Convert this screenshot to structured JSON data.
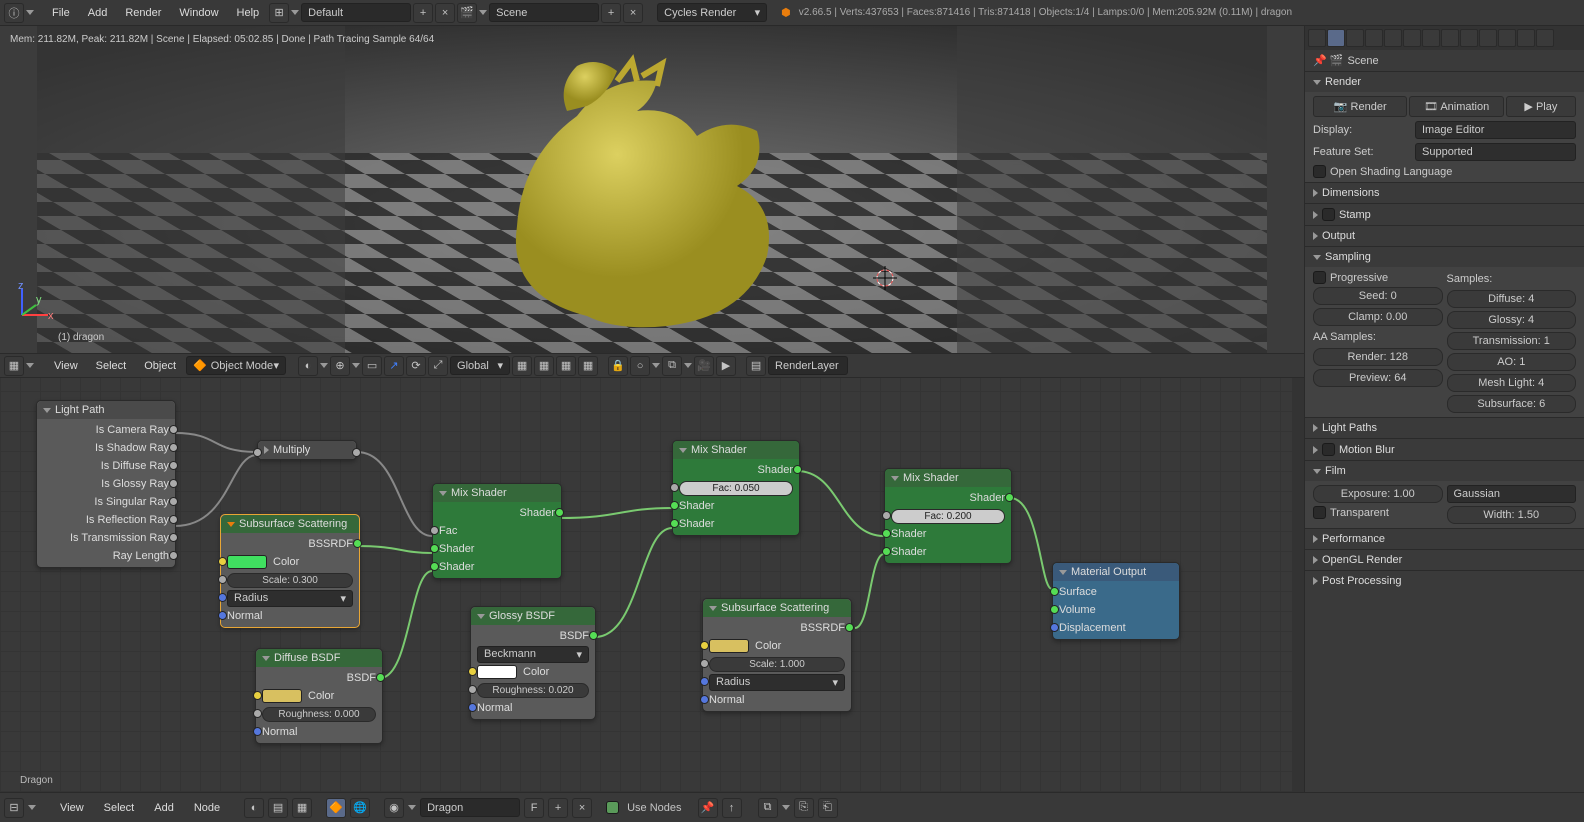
{
  "topmenu": {
    "file": "File",
    "add": "Add",
    "render": "Render",
    "window": "Window",
    "help": "Help"
  },
  "layout_preset": "Default",
  "scene_name": "Scene",
  "engine": "Cycles Render",
  "version_stats": "v2.66.5 | Verts:437653 | Faces:871416 | Tris:871418 | Objects:1/4 | Lamps:0/0 | Mem:205.92M (0.11M) | dragon",
  "render_stats": "Mem: 211.82M, Peak: 211.82M | Scene | Elapsed: 05:02.85 | Done | Path Tracing Sample 64/64",
  "viewport_obj": "(1) dragon",
  "vp_header": {
    "view": "View",
    "select": "Select",
    "object": "Object",
    "mode": "Object Mode",
    "orient": "Global",
    "layer": "RenderLayer"
  },
  "nodes": {
    "lightpath": {
      "title": "Light Path",
      "outs": [
        "Is Camera Ray",
        "Is Shadow Ray",
        "Is Diffuse Ray",
        "Is Glossy Ray",
        "Is Singular Ray",
        "Is Reflection Ray",
        "Is Transmission Ray",
        "Ray Length"
      ]
    },
    "multiply": {
      "title": "Multiply"
    },
    "sss1": {
      "title": "Subsurface Scattering",
      "out": "BSSRDF",
      "color": "Color",
      "scale": "Scale: 0.300",
      "radius": "Radius",
      "normal": "Normal"
    },
    "diffuse": {
      "title": "Diffuse BSDF",
      "out": "BSDF",
      "color": "Color",
      "rough": "Roughness: 0.000",
      "normal": "Normal"
    },
    "mix1": {
      "title": "Mix Shader",
      "out": "Shader",
      "fac": "Fac",
      "sh1": "Shader",
      "sh2": "Shader"
    },
    "glossy": {
      "title": "Glossy BSDF",
      "out": "BSDF",
      "dist": "Beckmann",
      "color": "Color",
      "rough": "Roughness: 0.020",
      "normal": "Normal"
    },
    "mix2": {
      "title": "Mix Shader",
      "out": "Shader",
      "fac": "Fac: 0.050",
      "sh1": "Shader",
      "sh2": "Shader"
    },
    "sss2": {
      "title": "Subsurface Scattering",
      "out": "BSSRDF",
      "color": "Color",
      "scale": "Scale: 1.000",
      "radius": "Radius",
      "normal": "Normal"
    },
    "mix3": {
      "title": "Mix Shader",
      "out": "Shader",
      "fac": "Fac: 0.200",
      "sh1": "Shader",
      "sh2": "Shader"
    },
    "output": {
      "title": "Material Output",
      "surface": "Surface",
      "volume": "Volume",
      "disp": "Displacement"
    }
  },
  "mat_name": "Dragon",
  "props": {
    "scene_crumb": "Scene",
    "render_hdr": "Render",
    "btn_render": "Render",
    "btn_anim": "Animation",
    "btn_play": "Play",
    "display_lbl": "Display:",
    "display_val": "Image Editor",
    "feature_lbl": "Feature Set:",
    "feature_val": "Supported",
    "osl": "Open Shading Language",
    "dimensions": "Dimensions",
    "stamp": "Stamp",
    "output": "Output",
    "sampling": "Sampling",
    "progressive": "Progressive",
    "samples_lbl": "Samples:",
    "seed": "Seed: 0",
    "clamp": "Clamp: 0.00",
    "aa": "AA Samples:",
    "render_s": "Render: 128",
    "preview_s": "Preview: 64",
    "diffuse_s": "Diffuse: 4",
    "glossy_s": "Glossy: 4",
    "transmission_s": "Transmission: 1",
    "ao_s": "AO: 1",
    "mesh_s": "Mesh Light: 4",
    "subsurf_s": "Subsurface: 6",
    "lightpaths": "Light Paths",
    "motion": "Motion Blur",
    "film": "Film",
    "exposure": "Exposure: 1.00",
    "gaussian": "Gaussian",
    "width": "Width: 1.50",
    "transparent": "Transparent",
    "performance": "Performance",
    "opengl": "OpenGL Render",
    "postproc": "Post Processing"
  },
  "ne_header": {
    "view": "View",
    "select": "Select",
    "add": "Add",
    "node": "Node",
    "mat": "Dragon",
    "f": "F",
    "usenodes": "Use Nodes"
  }
}
